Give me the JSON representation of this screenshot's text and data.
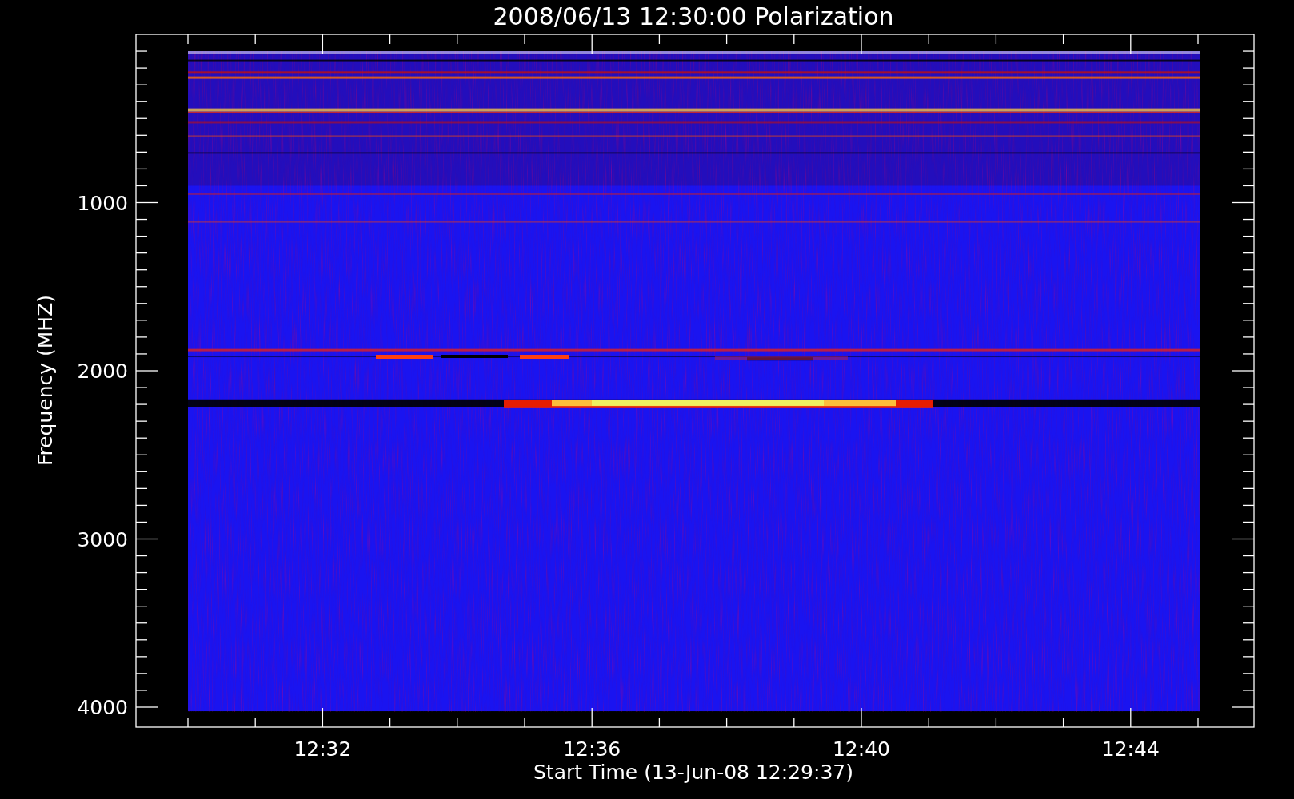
{
  "title": "2008/06/13 12:30:00 Polarization",
  "y_axis": {
    "label": "Frequency (MHZ)",
    "ticks": [
      "1000",
      "2000",
      "3000",
      "4000"
    ]
  },
  "x_axis": {
    "label": "Start Time (13-Jun-08 12:29:37)",
    "ticks": [
      "12:32",
      "12:36",
      "12:40",
      "12:44"
    ]
  }
}
